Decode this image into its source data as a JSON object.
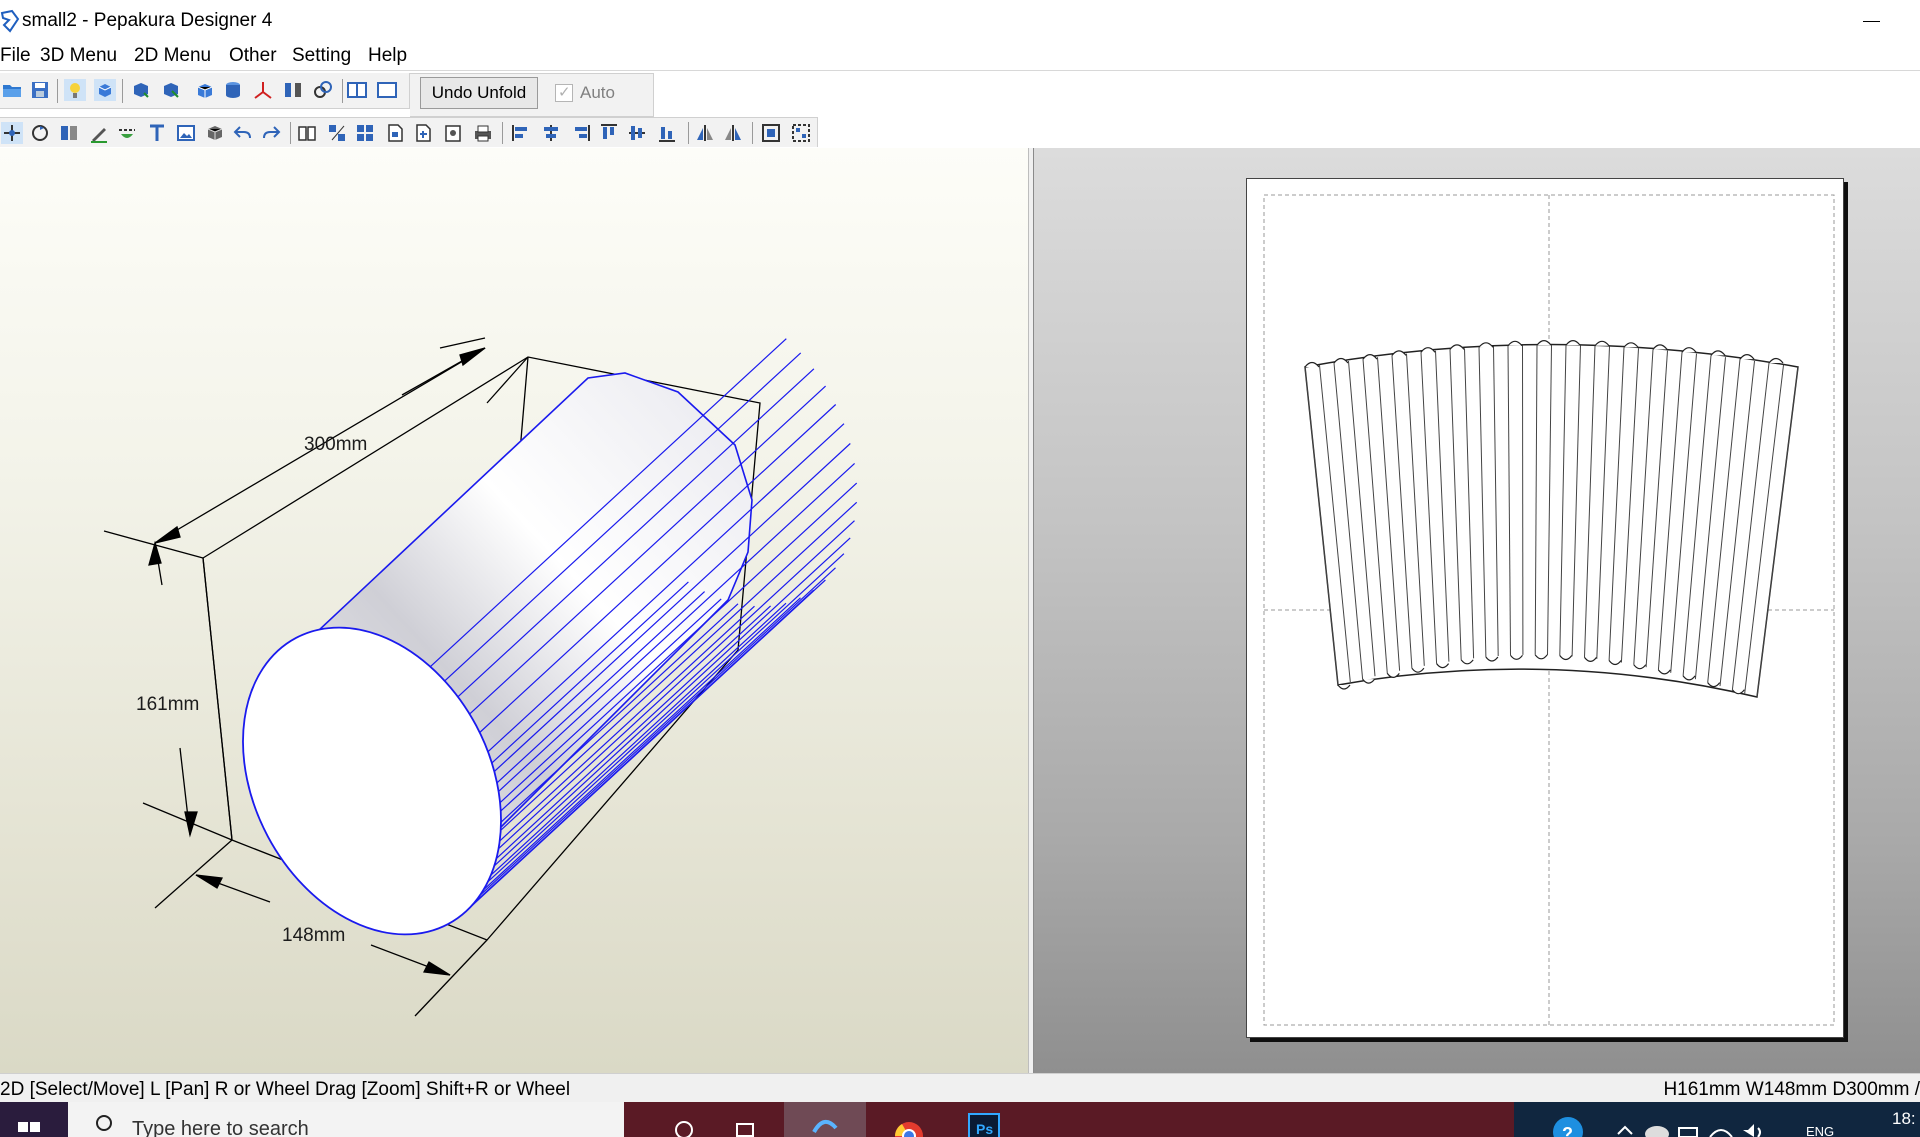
{
  "window": {
    "title": "small2 - Pepakura Designer 4"
  },
  "menu": {
    "items": [
      "File",
      "3D Menu",
      "2D Menu",
      "Other",
      "Setting",
      "Help"
    ]
  },
  "toolbar": {
    "undo_unfold_label": "Undo Unfold",
    "auto_label": "Auto",
    "auto_checked": true,
    "row1_icons": [
      "open-folder-icon",
      "save-icon",
      "light-icon",
      "cube-rotate-icon",
      "unfold-icon",
      "unfold-edit-icon",
      "box-icon",
      "cylinder-icon",
      "axis-icon",
      "split-icon",
      "link-icon",
      "layout-view-icon",
      "window-view-icon"
    ],
    "row2_icons": [
      "select-move-icon",
      "rotate-icon",
      "join-icon",
      "pencil-icon",
      "fold-icon",
      "text-icon",
      "image-icon",
      "cube-icon",
      "undo-icon",
      "redo-icon",
      "book-icon",
      "parts-icon",
      "grid-icon",
      "page-icon",
      "page-add-icon",
      "print-preview-icon",
      "print-icon",
      "align-left-icon",
      "align-center-icon",
      "align-right-icon",
      "align-top-icon",
      "align-middle-icon",
      "align-bottom-icon",
      "mirror-icon",
      "flip-icon",
      "fit-icon",
      "arrange-icon"
    ]
  },
  "view3d": {
    "dimensions": {
      "depth": "300mm",
      "height": "161mm",
      "width": "148mm"
    },
    "colors": {
      "edge": "#1a1aee",
      "dimension_line": "#000000"
    }
  },
  "statusbar": {
    "hint": "2D [Select/Move] L [Pan] R or Wheel Drag [Zoom] Shift+R or Wheel",
    "dimensions": "H161mm W148mm D300mm /"
  },
  "taskbar": {
    "search_placeholder": "Type here to search",
    "lang": "ENG",
    "clock": "18:",
    "apps": [
      "task-view-icon",
      "pepakura-icon",
      "chrome-icon",
      "photoshop-icon"
    ]
  }
}
